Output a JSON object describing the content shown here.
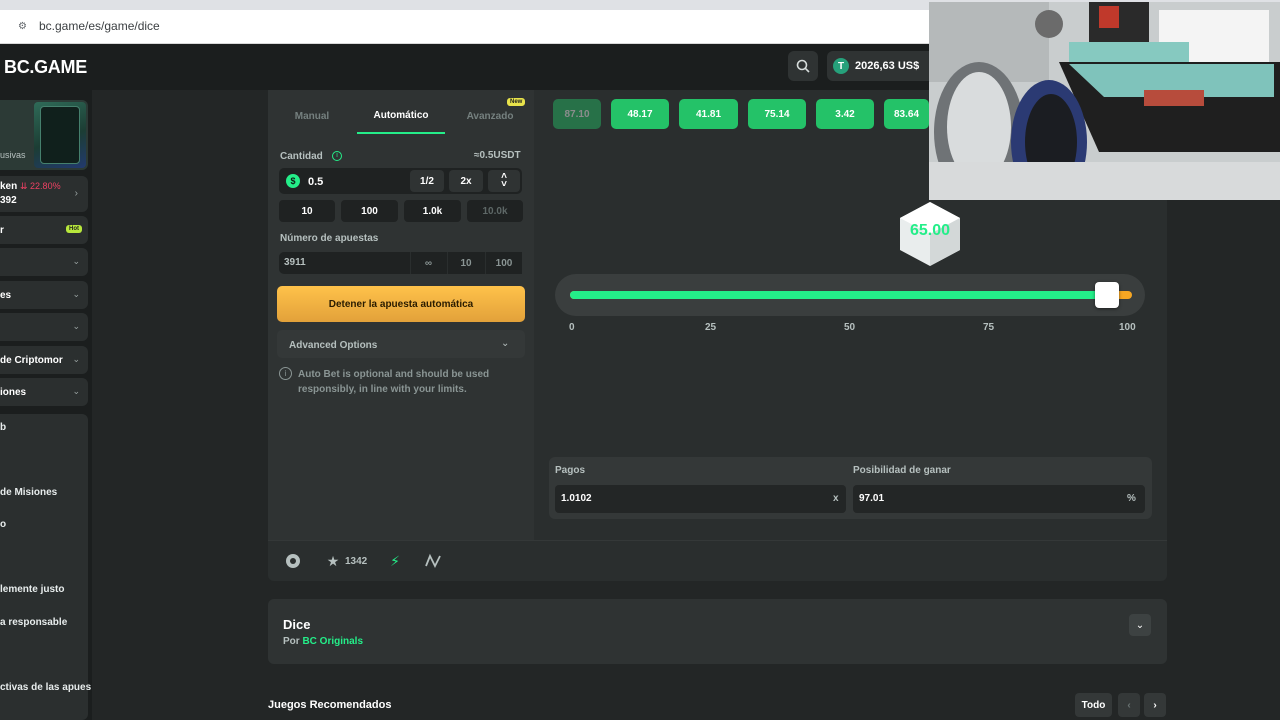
{
  "browser": {
    "url": "bc.game/es/game/dice"
  },
  "header": {
    "logo": "BC.GAME",
    "balance": "2026,63 US$",
    "currency_symbol": "T"
  },
  "sidebar": {
    "promo_text": "usivas",
    "token": {
      "name": "ken",
      "change": "22.80%",
      "value": "392"
    },
    "items": [
      {
        "label": "r",
        "badge": "Hot"
      },
      {
        "label": ""
      },
      {
        "label": "es"
      },
      {
        "label": ""
      },
      {
        "label": "de Criptomor"
      },
      {
        "label": "iones"
      }
    ],
    "links": [
      "b",
      "de Misiones",
      "o",
      "lemente justo",
      "a responsable",
      "ctivas de las apues"
    ]
  },
  "bet_panel": {
    "tabs": [
      "Manual",
      "Automático",
      "Avanzado"
    ],
    "new_badge": "New",
    "amount_label": "Cantidad",
    "amount_usdt": "≈0.5USDT",
    "amount_value": "0.5",
    "coin_symbol": "$",
    "half": "1/2",
    "double": "2x",
    "quick_amounts": [
      "10",
      "100",
      "1.0k",
      "10.0k"
    ],
    "bets_label": "Número de apuestas",
    "bets_value": "3911",
    "bets_options": [
      "∞",
      "10",
      "100"
    ],
    "stop_button": "Detener la apuesta automática",
    "advanced_options": "Advanced Options",
    "note": "Auto Bet is optional and should be used responsibly, in line with your limits."
  },
  "history": [
    "87.10",
    "48.17",
    "41.81",
    "75.14",
    "3.42",
    "83.64"
  ],
  "dice": {
    "result": "65.00",
    "slider_fraction": 0.97,
    "scale": [
      "0",
      "25",
      "50",
      "75",
      "100"
    ]
  },
  "stats": {
    "payout_label": "Pagos",
    "payout_value": "1.0102",
    "payout_unit": "x",
    "chance_label": "Posibilidad de ganar",
    "chance_value": "97.01",
    "chance_unit": "%"
  },
  "footer": {
    "favorites": "1342"
  },
  "game_info": {
    "name": "Dice",
    "by_prefix": "Por",
    "by_link": "BC Originals"
  },
  "recommended": {
    "title": "Juegos Recomendados",
    "all_button": "Todo"
  },
  "colors": {
    "accent": "#24ee89",
    "warning": "#f6a623",
    "background": "#232626",
    "panel": "#2f3333"
  }
}
